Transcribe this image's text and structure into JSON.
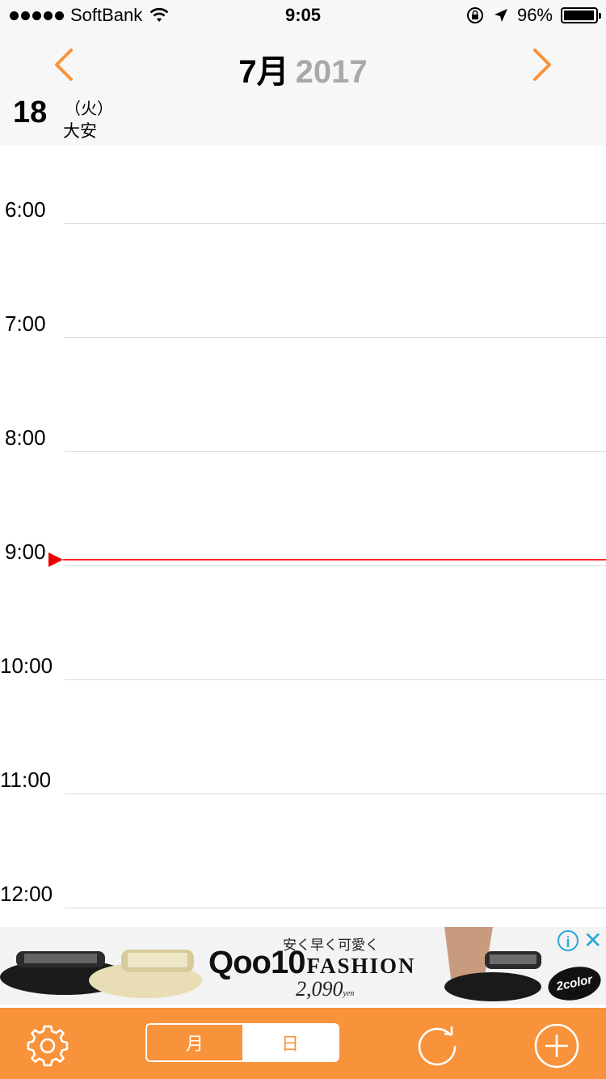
{
  "status_bar": {
    "carrier": "SoftBank",
    "time": "9:05",
    "battery": "96%"
  },
  "header": {
    "month": "7月",
    "year": "2017",
    "day": "18",
    "weekday": "（火）",
    "rokuyo": "大安"
  },
  "timeline": {
    "hours": [
      "6:00",
      "7:00",
      "8:00",
      "9:00",
      "10:00",
      "11:00",
      "12:00"
    ]
  },
  "ad": {
    "slogan": "安く早く可愛く",
    "brand": "Qoo10",
    "brand_suffix": "FASHION",
    "price": "2,090",
    "price_unit": "yen",
    "badge": "2color",
    "info": "i",
    "close": "✕"
  },
  "tabbar": {
    "month_label": "月",
    "day_label": "日",
    "selected": "日"
  },
  "colors": {
    "accent": "#f8933b",
    "now_line": "#ff2a2a",
    "header_bg": "#f7f7f7"
  },
  "icons": {
    "prev": "chevron-left-icon",
    "next": "chevron-right-icon",
    "settings": "gear-icon",
    "refresh": "refresh-icon",
    "add": "plus-circle-icon"
  }
}
